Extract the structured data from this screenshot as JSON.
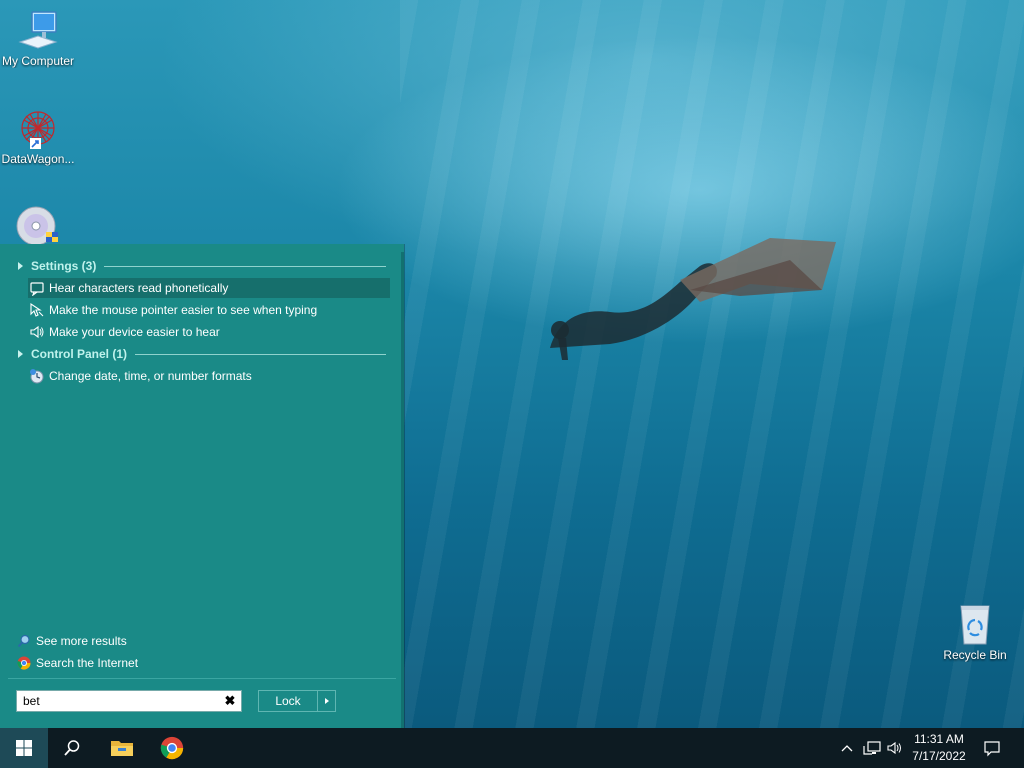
{
  "desktop": {
    "icons": [
      {
        "label": "My Computer"
      },
      {
        "label": "DataWagon..."
      },
      {
        "label": ""
      },
      {
        "label": "Recycle Bin"
      }
    ]
  },
  "start_menu": {
    "groups": [
      {
        "title": "Settings (3)",
        "results": [
          {
            "label": "Hear characters read phonetically",
            "icon": "narrator-icon",
            "selected": true
          },
          {
            "label": "Make the mouse pointer easier to see when typing",
            "icon": "mouse-pointer-icon",
            "selected": false
          },
          {
            "label": "Make your device easier to hear",
            "icon": "speaker-icon",
            "selected": false
          }
        ]
      },
      {
        "title": "Control Panel (1)",
        "results": [
          {
            "label": "Change date, time, or number formats",
            "icon": "region-clock-icon",
            "selected": false
          }
        ]
      }
    ],
    "see_more": "See more results",
    "search_internet": "Search the Internet",
    "search": {
      "value": "bet",
      "placeholder": ""
    },
    "lock_label": "Lock"
  },
  "taskbar": {
    "pinned": [
      "search-icon",
      "file-explorer-icon",
      "chrome-icon"
    ],
    "clock": {
      "time": "11:31 AM",
      "date": "7/17/2022"
    }
  },
  "colors": {
    "menu_bg": "#1a8a87",
    "menu_selected": "#166f6c",
    "group_title": "#bff2ec",
    "taskbar_bg": "#0d1b22"
  }
}
